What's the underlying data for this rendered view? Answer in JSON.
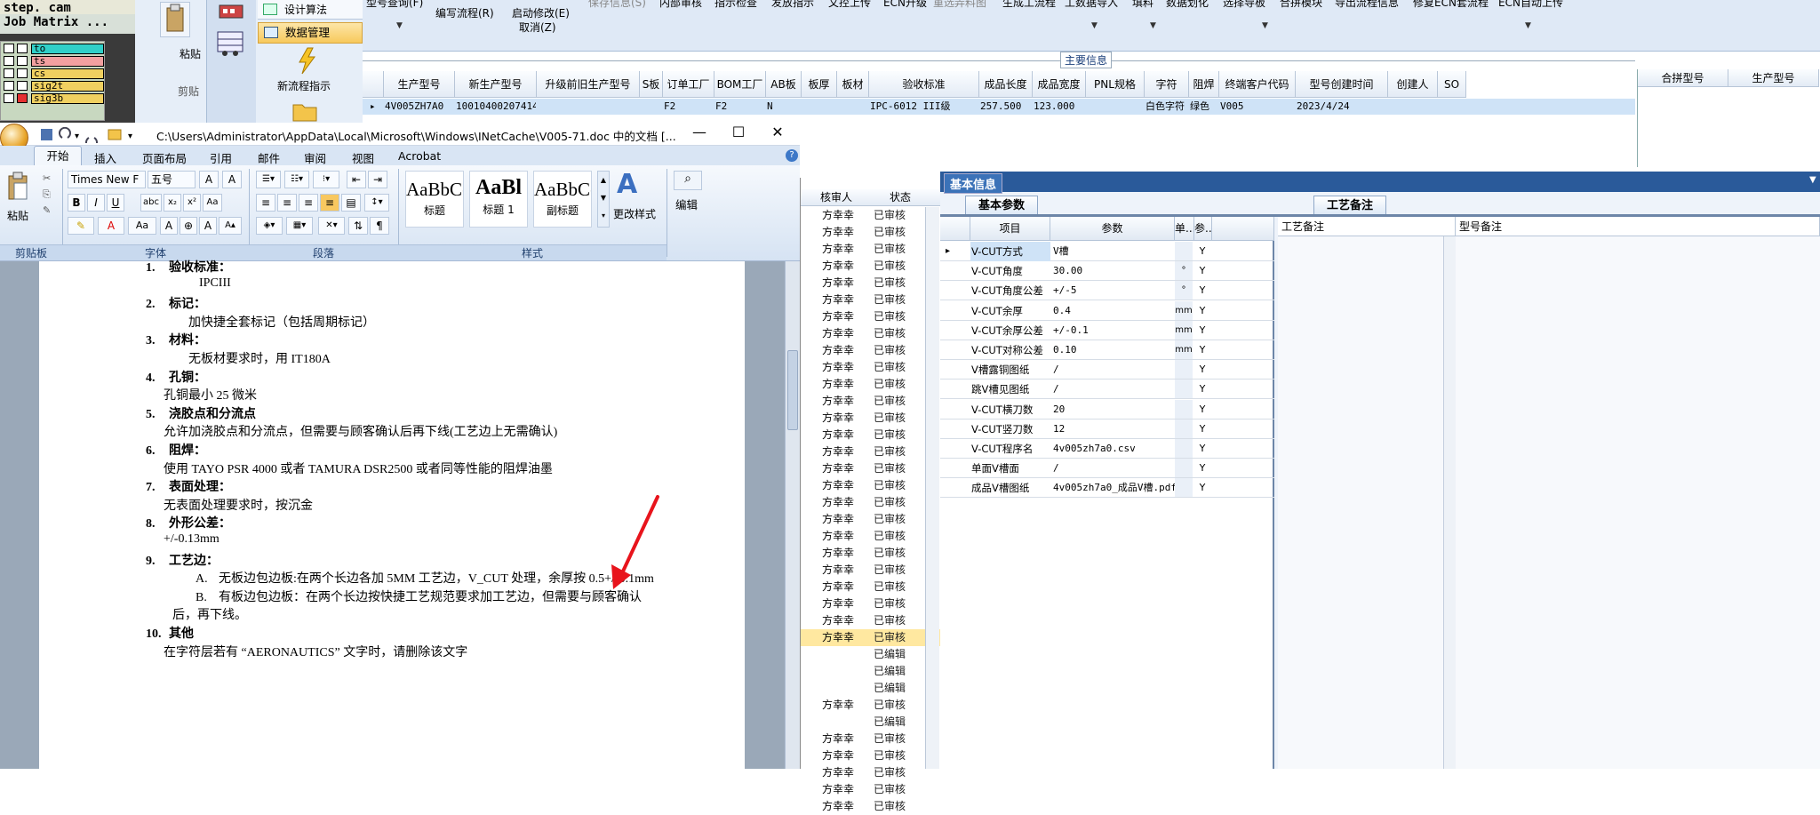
{
  "cam": {
    "header1": "step. cam",
    "header2": "Job Matrix ...",
    "layers": [
      {
        "name": "to",
        "color": "#30d0c8",
        "marker": "#ffffff"
      },
      {
        "name": "ts",
        "color": "#f2a0a0",
        "marker": "#ffffff"
      },
      {
        "name": "cs",
        "color": "#f0d060",
        "marker": "#ffffff"
      },
      {
        "name": "sig2t",
        "color": "#f0d060",
        "marker": "#ffffff"
      },
      {
        "name": "sig3b",
        "color": "#f0d060",
        "marker": "#e53030"
      }
    ]
  },
  "side_menu": {
    "paste": "粘贴",
    "clipboard": "剪贴",
    "items": [
      "设计算法",
      "数据管理"
    ],
    "new_flow": "新流程指示"
  },
  "top_toolbar": {
    "row1": [
      "型号查询(F)",
      "编写流程(R)",
      "启动修改(E)",
      "保存信息(S)",
      "内部审核",
      "指示检查",
      "发放指示",
      "文控上传",
      "ECN升级",
      "重选弄料图",
      "生成工流程",
      "工数据导入",
      "填料",
      "数据划化",
      "选择导板",
      "合拼模块",
      "导出流程信息",
      "修复ECN套流程",
      "ECN自动上传"
    ],
    "cancel": "取消(Z)"
  },
  "main_info": {
    "title": "主要信息",
    "headers": [
      "生产型号",
      "新生产型号",
      "升级前旧生产型号",
      "S板",
      "订单工厂",
      "BOM工厂",
      "AB板",
      "板厚",
      "板材",
      "验收标准",
      "成品长度",
      "成品宽度",
      "PNL规格",
      "字符",
      "阻焊",
      "终端客户代码",
      "型号创建时间",
      "创建人",
      "SO"
    ],
    "row": [
      "4V005ZH7A0",
      "10010400207414",
      "",
      "",
      "F2",
      "F2",
      "N",
      "",
      "",
      "IPC-6012 III级",
      "257.500",
      "123.000",
      "",
      "白色字符",
      "绿色",
      "V005",
      "2023/4/24",
      "",
      ""
    ],
    "merge_headers": [
      "合拼型号",
      "生产型号"
    ]
  },
  "review_list": {
    "headers": [
      "核审人",
      "状态"
    ],
    "rows": [
      [
        "方幸幸",
        "已审核"
      ],
      [
        "方幸幸",
        "已审核"
      ],
      [
        "方幸幸",
        "已审核"
      ],
      [
        "方幸幸",
        "已审核"
      ],
      [
        "方幸幸",
        "已审核"
      ],
      [
        "方幸幸",
        "已审核"
      ],
      [
        "方幸幸",
        "已审核"
      ],
      [
        "方幸幸",
        "已审核"
      ],
      [
        "方幸幸",
        "已审核"
      ],
      [
        "方幸幸",
        "已审核"
      ],
      [
        "方幸幸",
        "已审核"
      ],
      [
        "方幸幸",
        "已审核"
      ],
      [
        "方幸幸",
        "已审核"
      ],
      [
        "方幸幸",
        "已审核"
      ],
      [
        "方幸幸",
        "已审核"
      ],
      [
        "方幸幸",
        "已审核"
      ],
      [
        "方幸幸",
        "已审核"
      ],
      [
        "方幸幸",
        "已审核"
      ],
      [
        "方幸幸",
        "已审核"
      ],
      [
        "方幸幸",
        "已审核"
      ],
      [
        "方幸幸",
        "已审核"
      ],
      [
        "方幸幸",
        "已审核"
      ],
      [
        "方幸幸",
        "已审核"
      ],
      [
        "方幸幸",
        "已审核"
      ],
      [
        "方幸幸",
        "已审核"
      ],
      [
        "方幸幸",
        "已审核"
      ],
      [
        "",
        "已编辑"
      ],
      [
        "",
        "已编辑"
      ],
      [
        "",
        "已编辑"
      ],
      [
        "方幸幸",
        "已审核"
      ],
      [
        "",
        "已编辑"
      ],
      [
        "方幸幸",
        "已审核"
      ],
      [
        "方幸幸",
        "已审核"
      ],
      [
        "方幸幸",
        "已审核"
      ],
      [
        "方幸幸",
        "已审核"
      ],
      [
        "方幸幸",
        "已审核"
      ]
    ]
  },
  "basic_info": {
    "title": "基本信息",
    "params_tab": "基本参数",
    "process_tab": "工艺备注",
    "param_headers": [
      "项目",
      "参数",
      "单...",
      "参..."
    ],
    "params": [
      [
        "V-CUT方式",
        "V槽",
        "",
        "Y"
      ],
      [
        "V-CUT角度",
        "30.00",
        "°",
        "Y"
      ],
      [
        "V-CUT角度公差",
        "+/-5",
        "°",
        "Y"
      ],
      [
        "V-CUT余厚",
        "0.4",
        "mm",
        "Y"
      ],
      [
        "V-CUT余厚公差",
        "+/-0.1",
        "mm",
        "Y"
      ],
      [
        "V-CUT对称公差",
        "0.10",
        "mm",
        "Y"
      ],
      [
        "V槽露铜图纸",
        "/",
        "",
        "Y"
      ],
      [
        "跳V槽见图纸",
        "/",
        "",
        "Y"
      ],
      [
        "V-CUT横刀数",
        "20",
        "",
        "Y"
      ],
      [
        "V-CUT竖刀数",
        "12",
        "",
        "Y"
      ],
      [
        "V-CUT程序名",
        "4v005zh7a0.csv",
        "",
        "Y"
      ],
      [
        "单面V槽面",
        "/",
        "",
        "Y"
      ],
      [
        "成品V槽图纸",
        "4v005zh7a0_成品V槽.pdf",
        "",
        "Y"
      ]
    ],
    "note_headers": [
      "工艺备注",
      "型号备注"
    ]
  },
  "word": {
    "title": "C:\\Users\\Administrator\\AppData\\Local\\Microsoft\\Windows\\INetCache\\V005-71.doc 中的文档 [...",
    "tabs": [
      "开始",
      "插入",
      "页面布局",
      "引用",
      "邮件",
      "审阅",
      "视图",
      "Acrobat"
    ],
    "font_name": "Times New F",
    "font_size": "五号",
    "groups": [
      "剪贴板",
      "字体",
      "段落",
      "样式"
    ],
    "paste": "粘贴",
    "styles": [
      {
        "sample": "AaBbC(",
        "name": "标题"
      },
      {
        "sample": "AaBl",
        "name": "标题 1"
      },
      {
        "sample": "AaBbC(",
        "name": "副标题"
      }
    ],
    "change_styles": "更改样式",
    "edit": "编辑",
    "doc_lines": [
      {
        "num": "1.",
        "text": "验收标准：",
        "bold": true
      },
      {
        "num": "",
        "text": "IPCIII",
        "bold": false
      },
      {
        "num": "2.",
        "text": "标记：",
        "bold": true
      },
      {
        "num": "",
        "text": "加快捷全套标记（包括周期标记）",
        "bold": false
      },
      {
        "num": "3.",
        "text": "材料：",
        "bold": true
      },
      {
        "num": "",
        "text": "无板材要求时，用 IT180A",
        "bold": false
      },
      {
        "num": "4.",
        "text": "孔铜：",
        "bold": true
      },
      {
        "num": "",
        "text": "孔铜最小 25 微米",
        "bold": false
      },
      {
        "num": "5.",
        "text": "浇胶点和分流点",
        "bold": true
      },
      {
        "num": "",
        "text": "允许加浇胶点和分流点，但需要与顾客确认后再下线(工艺边上无需确认)",
        "bold": false
      },
      {
        "num": "6.",
        "text": "阻焊：",
        "bold": true
      },
      {
        "num": "",
        "text": "使用 TAYO PSR 4000    或者     TAMURA    DSR2500  或者同等性能的阻焊油墨",
        "bold": false
      },
      {
        "num": "7.",
        "text": "表面处理：",
        "bold": true
      },
      {
        "num": "",
        "text": "无表面处理要求时，按沉金",
        "bold": false
      },
      {
        "num": "8.",
        "text": "外形公差：",
        "bold": true
      },
      {
        "num": "",
        "text": "+/-0.13mm",
        "bold": false
      },
      {
        "num": "9.",
        "text": "工艺边：",
        "bold": true
      },
      {
        "num": "A.",
        "text": "无板边包边板:在两个长边各加 5MM 工艺边，V_CUT 处理，余厚按 0.5+/-0.1mm",
        "bold": false
      },
      {
        "num": "B.",
        "text": "有板边包边板：在两个长边按快捷工艺规范要求加工艺边，但需要与顾客确认",
        "bold": false
      },
      {
        "num": "",
        "text": "后，再下线。",
        "bold": false
      },
      {
        "num": "10.",
        "text": "其他",
        "bold": true
      },
      {
        "num": "",
        "text": "在字符层若有 “AERONAUTICS” 文字时，请删除该文字",
        "bold": false
      }
    ]
  },
  "colors": {
    "selection_row": "#cfe3f7",
    "panel_bar": "#2a5a9a",
    "arrow": "#e8141c",
    "highlight_row": "#ffe8a0"
  }
}
